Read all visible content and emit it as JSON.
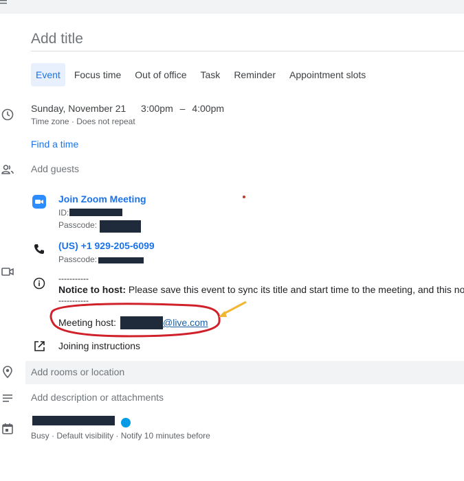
{
  "event": {
    "title_placeholder": "Add title",
    "tabs": [
      {
        "label": "Event",
        "active": true
      },
      {
        "label": "Focus time",
        "active": false
      },
      {
        "label": "Out of office",
        "active": false
      },
      {
        "label": "Task",
        "active": false
      },
      {
        "label": "Reminder",
        "active": false
      },
      {
        "label": "Appointment slots",
        "active": false
      }
    ],
    "date_time": {
      "date": "Sunday, November 21",
      "start": "3:00pm",
      "separator": "–",
      "end": "4:00pm",
      "timezone": "Time zone",
      "repeat": "Does not repeat"
    },
    "find_time_label": "Find a time",
    "guests_placeholder": "Add guests",
    "zoom": {
      "join_label": "Join Zoom Meeting",
      "id_label": "ID:",
      "passcode_label": "Passcode:",
      "phone": "(US) +1 929-205-6099",
      "phone_passcode_label": "Passcode:",
      "dashes_top": "-----------",
      "notice_bold": "Notice to host:",
      "notice_text": "Please save this event to sync its title and start time to the meeting, and this not",
      "dashes_bottom": "-----------",
      "host_label": "Meeting host:",
      "host_email_suffix": "@live.com",
      "joining_instructions": "Joining instructions"
    },
    "location_placeholder": "Add rooms or location",
    "description_placeholder": "Add description or attachments",
    "calendar": {
      "status": "Busy",
      "visibility": "Default visibility",
      "notify": "Notify 10 minutes before",
      "color": "#039be5"
    }
  },
  "annotation": {
    "circle_color": "#d0202a",
    "arrow_color": "#f2b632"
  }
}
